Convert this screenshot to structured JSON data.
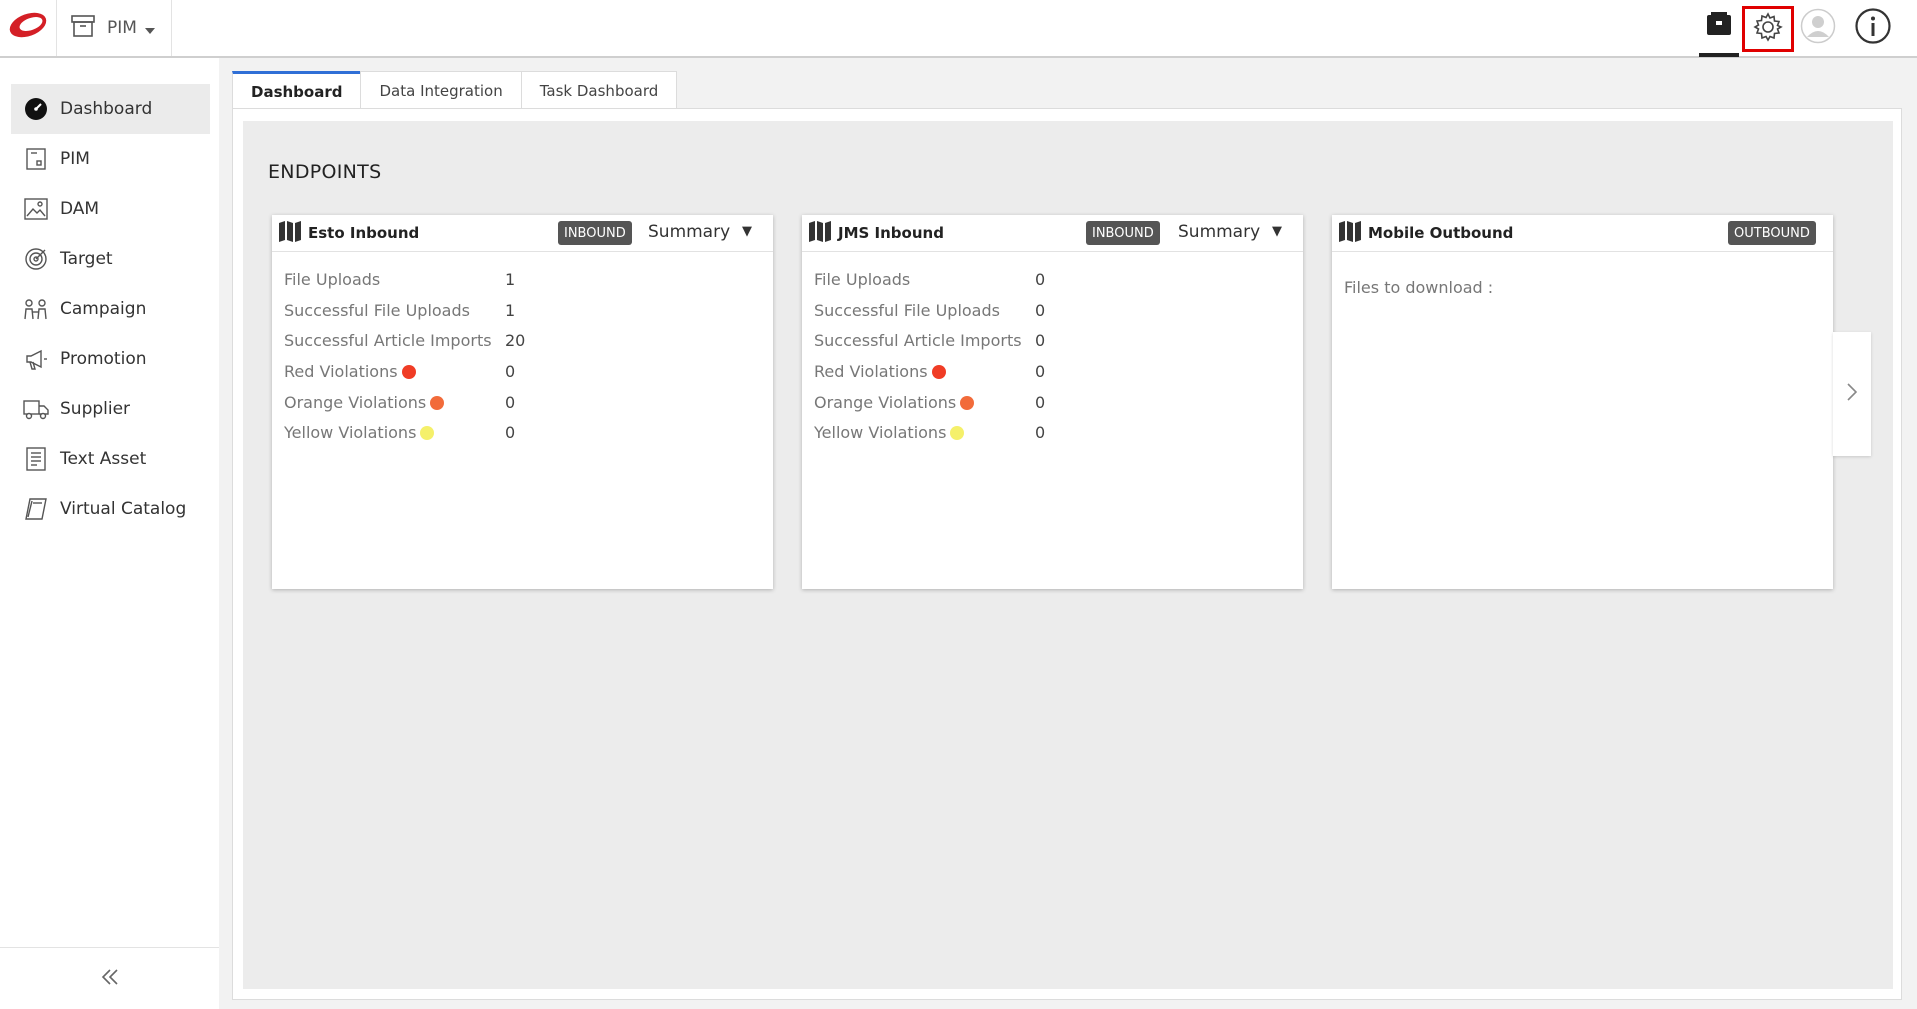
{
  "header": {
    "module_label": "PIM"
  },
  "sidebar": {
    "items": [
      {
        "label": "Dashboard",
        "icon": "dashboard-icon",
        "active": true
      },
      {
        "label": "PIM",
        "icon": "pim-icon"
      },
      {
        "label": "DAM",
        "icon": "image-icon"
      },
      {
        "label": "Target",
        "icon": "target-icon"
      },
      {
        "label": "Campaign",
        "icon": "campaign-icon"
      },
      {
        "label": "Promotion",
        "icon": "megaphone-icon"
      },
      {
        "label": "Supplier",
        "icon": "truck-icon"
      },
      {
        "label": "Text Asset",
        "icon": "document-icon"
      },
      {
        "label": "Virtual Catalog",
        "icon": "catalog-icon"
      }
    ]
  },
  "tabs": [
    {
      "label": "Dashboard",
      "active": true
    },
    {
      "label": "Data Integration"
    },
    {
      "label": "Task Dashboard"
    }
  ],
  "main": {
    "section_title": "ENDPOINTS"
  },
  "cards": [
    {
      "title": "Esto Inbound",
      "badge": "INBOUND",
      "summary": "Summary",
      "stats": [
        {
          "label": "File Uploads",
          "value": "1"
        },
        {
          "label": "Successful File Uploads",
          "value": "1"
        },
        {
          "label": "Successful Article Imports",
          "value": "20"
        },
        {
          "label": "Red Violations",
          "value": "0",
          "dot": "#f03c25"
        },
        {
          "label": "Orange Violations",
          "value": "0",
          "dot": "#f26b3a"
        },
        {
          "label": "Yellow Violations",
          "value": "0",
          "dot": "#f5f06a"
        }
      ]
    },
    {
      "title": "JMS Inbound",
      "badge": "INBOUND",
      "summary": "Summary",
      "stats": [
        {
          "label": "File Uploads",
          "value": "0"
        },
        {
          "label": "Successful File Uploads",
          "value": "0"
        },
        {
          "label": "Successful Article Imports",
          "value": "0"
        },
        {
          "label": "Red Violations",
          "value": "0",
          "dot": "#f03c25"
        },
        {
          "label": "Orange Violations",
          "value": "0",
          "dot": "#f26b3a"
        },
        {
          "label": "Yellow Violations",
          "value": "0",
          "dot": "#f5f06a"
        }
      ]
    },
    {
      "title": "Mobile Outbound",
      "badge": "OUTBOUND",
      "files_text": "Files to download :"
    }
  ],
  "colors": {
    "accent": "#2f6fd6",
    "highlight": "#e00000",
    "brand": "#d41f26"
  }
}
